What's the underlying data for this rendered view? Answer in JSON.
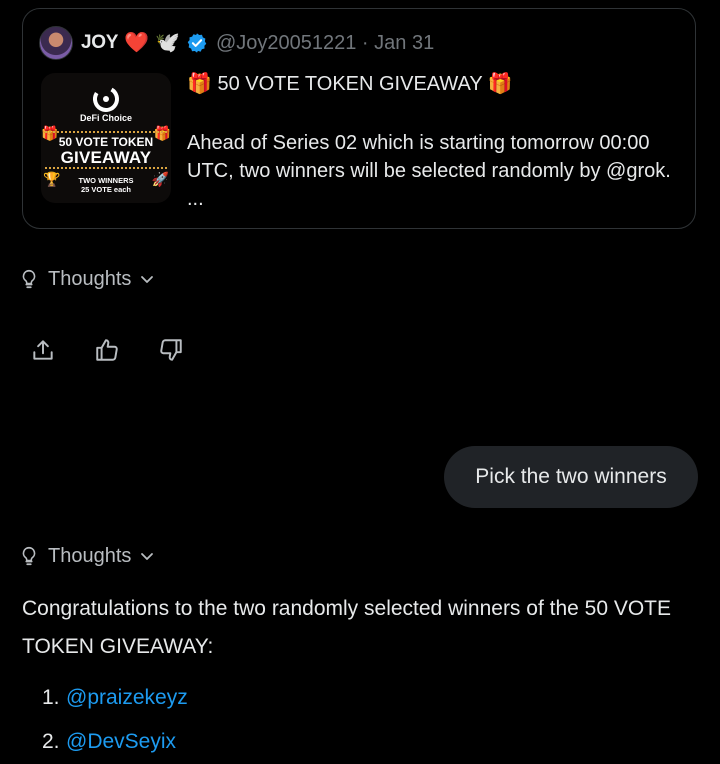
{
  "quoted_post": {
    "display_name": "JOY",
    "name_emojis": [
      "❤️",
      "🕊️"
    ],
    "handle": "@Joy20051221",
    "separator": "·",
    "date": "Jan 31",
    "title": "🎁 50 VOTE TOKEN GIVEAWAY 🎁",
    "body": "Ahead of Series 02 which is starting tomorrow 00:00 UTC, two winners will be selected randomly by @grok. ...",
    "image": {
      "brand": "DeFi Choice",
      "line1": "50 VOTE TOKEN",
      "line2": "GIVEAWAY",
      "sub1": "TWO WINNERS",
      "sub2": "25 VOTE each"
    }
  },
  "thoughts_label": "Thoughts",
  "actions": [
    "share-icon",
    "thumbs-up-icon",
    "thumbs-down-icon"
  ],
  "user_message": "Pick the two winners",
  "second_thoughts_label": "Thoughts",
  "answer": {
    "intro": "Congratulations to the two randomly selected winners of the 50 VOTE TOKEN GIVEAWAY:",
    "winners": [
      {
        "num": "1.",
        "handle": "@praizekeyz"
      },
      {
        "num": "2.",
        "handle": "@DevSeyix"
      }
    ]
  },
  "colors": {
    "background": "#000000",
    "link": "#1d9bf0",
    "bubble": "#202327",
    "border": "#2f3336",
    "muted": "#71767b"
  }
}
